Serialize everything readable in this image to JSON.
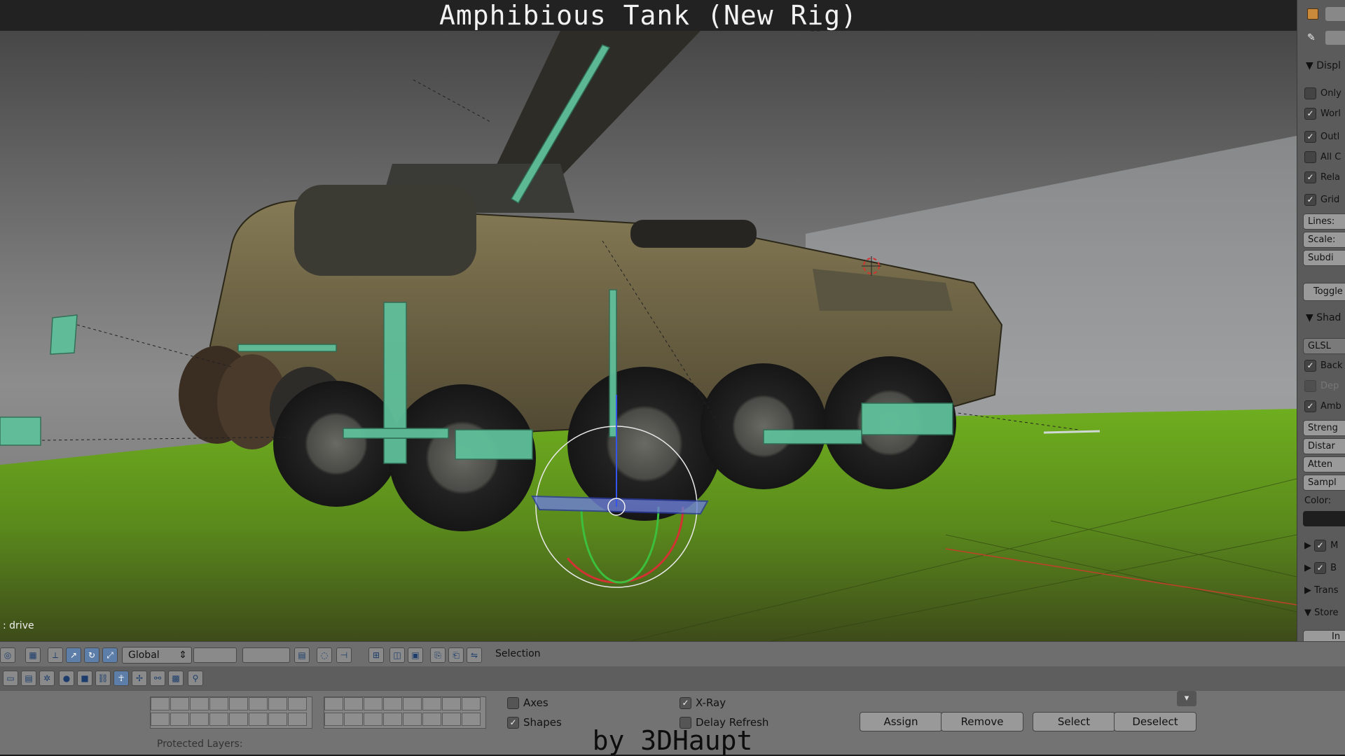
{
  "title": "Amphibious Tank (New Rig)",
  "credit": "by 3DHaupt",
  "viewport": {
    "object_label": ": drive"
  },
  "properties_panel": {
    "section_display": "Displ",
    "display_options": [
      {
        "label": "Only",
        "checked": false
      },
      {
        "label": "Worl",
        "checked": true
      },
      {
        "label": "Outl",
        "checked": true
      },
      {
        "label": "All C",
        "checked": false
      },
      {
        "label": "Rela",
        "checked": true
      },
      {
        "label": "Grid",
        "checked": true
      }
    ],
    "grid_fields": [
      "Lines:",
      "Scale:",
      "Subdi"
    ],
    "toggle_label": "Toggle",
    "section_shading": "Shad",
    "shading_mode": "GLSL",
    "shading_options": [
      {
        "label": "Back",
        "checked": true
      },
      {
        "label": "Dep",
        "checked": false
      },
      {
        "label": "Amb",
        "checked": true
      }
    ],
    "ao_fields": [
      "Streng",
      "Distar",
      "Atten",
      "Sampl"
    ],
    "color_label": "Color:",
    "subsections": [
      {
        "label": "M",
        "checked": true
      },
      {
        "label": "B",
        "checked": true
      },
      {
        "label": "Trans",
        "checked": null
      },
      {
        "label": "Store",
        "checked": null
      }
    ],
    "bottom_button": "In"
  },
  "header_bar": {
    "orientation": "Global",
    "selection_label": "Selection"
  },
  "bottom_panel": {
    "protected_layers_label": "Protected Layers:",
    "options": [
      {
        "label": "Axes",
        "checked": false
      },
      {
        "label": "Shapes",
        "checked": true
      },
      {
        "label": "X-Ray",
        "checked": true
      },
      {
        "label": "Delay Refresh",
        "checked": false
      }
    ],
    "buttons": [
      "Assign",
      "Remove",
      "Select",
      "Deselect"
    ]
  },
  "colors": {
    "bone_green": "#5fbf9a",
    "ground_green": "#5a9a1a",
    "tank_olive": "#6b6244",
    "panel_gray": "#737373"
  }
}
